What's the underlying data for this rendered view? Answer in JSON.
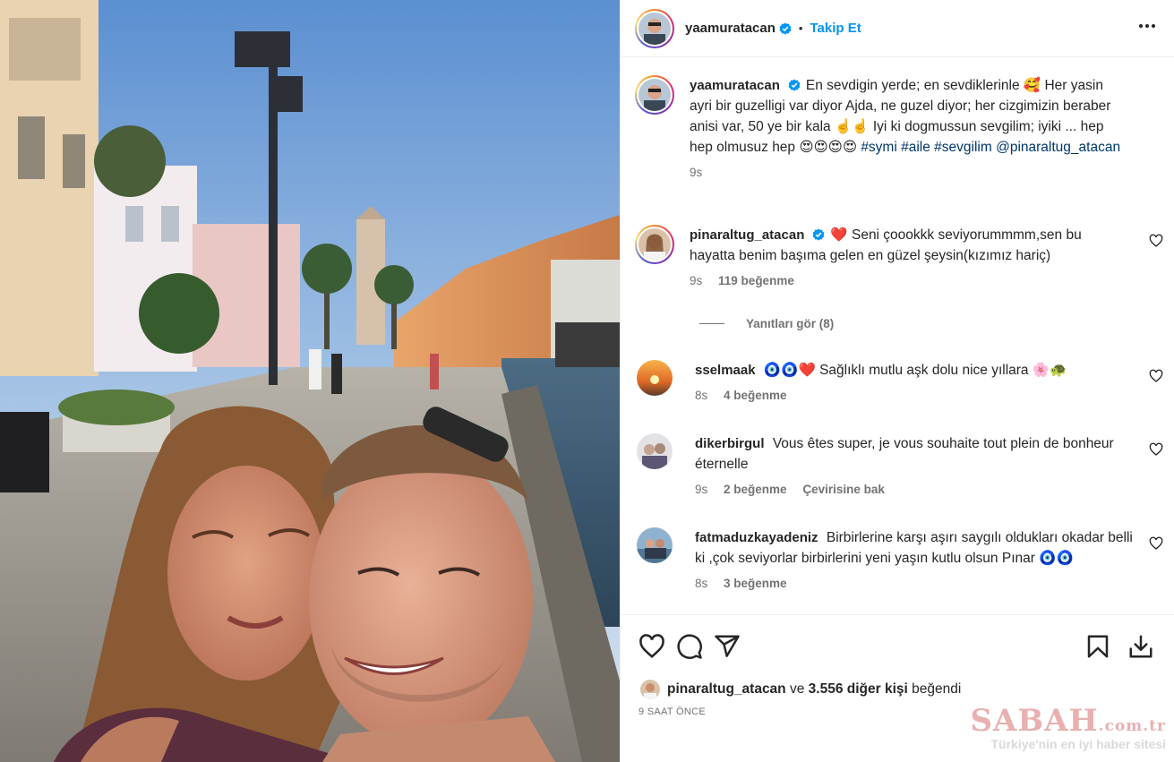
{
  "post": {
    "author": "yaamuratacan",
    "follow_label": "Takip Et",
    "separator": "•"
  },
  "caption": {
    "username": "yaamuratacan",
    "text": "En sevdigin yerde; en sevdiklerinle 🥰 Her yasin ayri bir guzelligi var diyor Ajda, ne guzel diyor; her cizgimizin beraber anisi var, 50 ye bir kala ☝️☝️ Iyi ki dogmussun sevgilim; iyiki ... hep hep olmusuz hep 😍😍😍😍",
    "hashtags": [
      "#symi",
      "#aile",
      "#sevgilim"
    ],
    "mention": "@pinaraltug_atacan",
    "time": "9s"
  },
  "comments": [
    {
      "username": "pinaraltug_atacan",
      "text": "❤️ Seni çoookkk seviyorummmm,sen bu hayatta benim başıma gelen en güzel şeysin(kızımız hariç)",
      "time": "9s",
      "likes": "119 beğenme"
    },
    {
      "username": "sselmaak",
      "text": "🧿🧿❤️ Sağlıklı mutlu aşk dolu nice yıllara 🌸🐢",
      "time": "8s",
      "likes": "4 beğenme"
    },
    {
      "username": "dikerbirgul",
      "text": "Vous êtes super, je vous souhaite tout plein de bonheur éternelle",
      "time": "9s",
      "likes": "2 beğenme",
      "translate": "Çevirisine bak"
    },
    {
      "username": "fatmaduzkayadeniz",
      "text": "Birbirlerine karşı aşırı saygılı oldukları okadar belli ki ,çok seviyorlar birbirlerini yeni yaşın kutlu olsun Pınar 🧿🧿",
      "time": "8s",
      "likes": "3 beğenme"
    }
  ],
  "replies": {
    "label": "Yanıtları gör (8)"
  },
  "likes_summary": {
    "user": "pinaraltug_atacan",
    "connector": "ve",
    "others": "3.556 diğer kişi",
    "suffix": "beğendi"
  },
  "timestamp": "9 SAAT ÖNCE",
  "watermark": {
    "brand": "SABAH",
    "domain": ".com.tr",
    "tagline": "Türkiye'nin en iyi haber sitesi"
  },
  "icons": {
    "verified": "verified-badge-icon",
    "more": "more-options-icon",
    "like": "heart-icon",
    "comment": "comment-icon",
    "share": "share-icon",
    "save": "bookmark-icon",
    "download": "download-icon"
  },
  "colors": {
    "link": "#0095f6",
    "hashtag": "#00376b",
    "secondary_text": "#737373",
    "divider": "#efefef"
  }
}
